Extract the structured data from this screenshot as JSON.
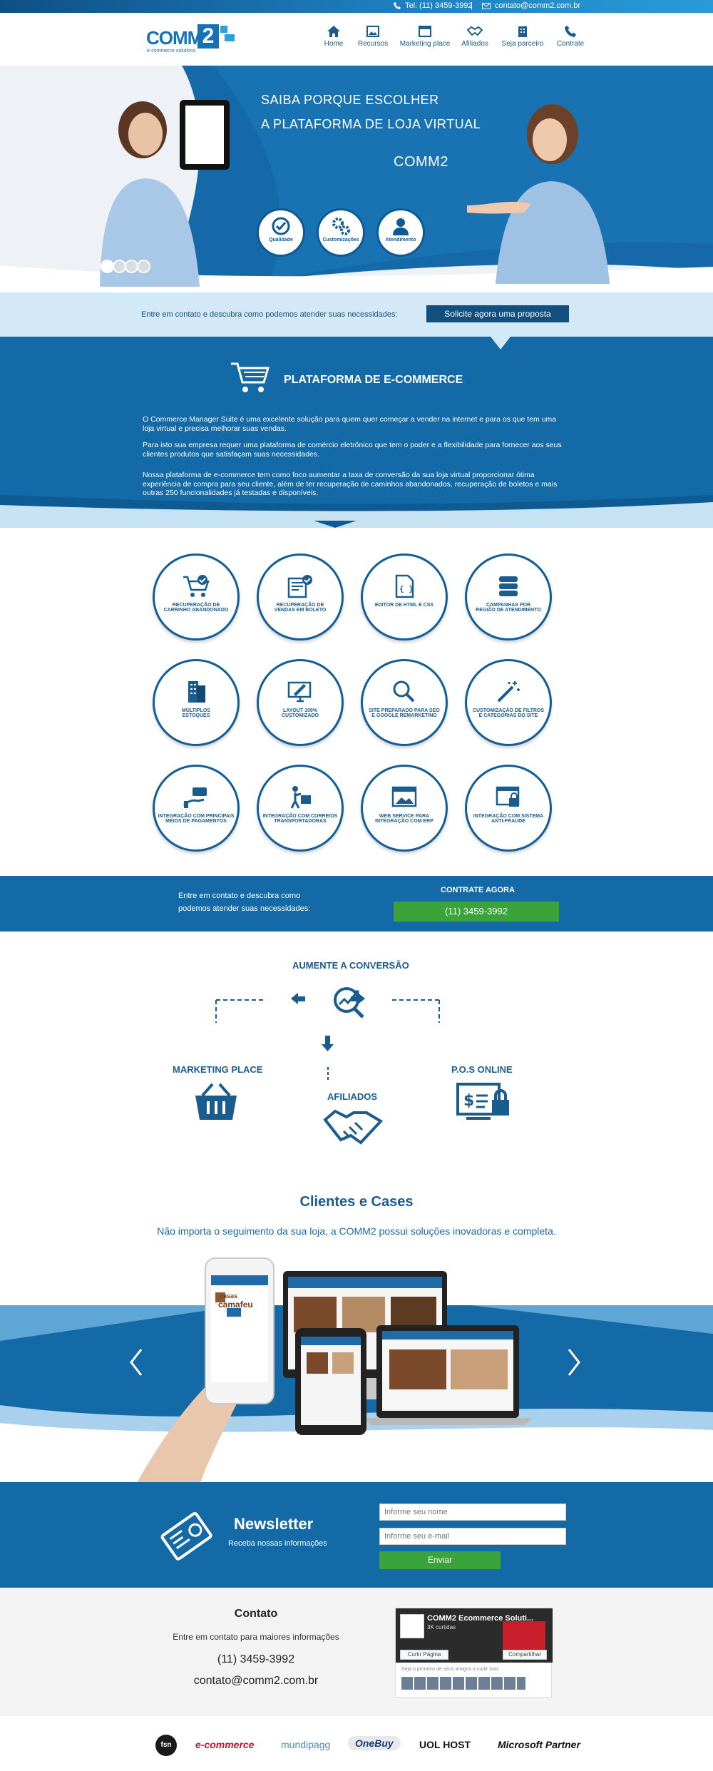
{
  "topbar": {
    "phone": "Tel: (11) 3459-3992",
    "separator": "|",
    "email": "contato@comm2.com.br"
  },
  "brand": {
    "logo_text": "COMM",
    "logo_number": "2",
    "logo_sub": "e-commerce solutions"
  },
  "nav": [
    {
      "label": "Home",
      "icon": "home-icon"
    },
    {
      "label": "Recursos",
      "icon": "image-icon"
    },
    {
      "label": "Marketing place",
      "icon": "browser-icon"
    },
    {
      "label": "Afiliados",
      "icon": "handshake-icon"
    },
    {
      "label": "Seja parceiro",
      "icon": "building-icon"
    },
    {
      "label": "Contrate",
      "icon": "phone-icon"
    }
  ],
  "hero": {
    "line1": "SAIBA PORQUE ESCOLHER",
    "line2": "A PLATAFORMA DE LOJA VIRTUAL",
    "line3": "COMM2",
    "badges": [
      "Qualidade",
      "Customizações",
      "Atendimento"
    ]
  },
  "cta": {
    "text": "Entre em contato e descubra como podemos atender suas necessidades:",
    "button": "Solicite agora uma proposta"
  },
  "platform": {
    "title": "PLATAFORMA DE E-COMMERCE",
    "p1": "O Commerce Manager Suite é uma excelente solução para quem quer começar a vender na internet e para os que tem uma loja virtual e precisa melhorar suas vendas.",
    "p2": "Para isto sua empresa requer uma plataforma de comércio eletrônico que tem o poder e a flexibilidade para fornecer aos seus clientes produtos que satisfaçam suas necessidades.",
    "p3": "Nossa plataforma de e-commerce tem como foco aumentar a taxa de conversão da sua loja virtual proporcionar ótima experiência de compra para seu cliente, além de ter recuperação de caminhos abandonados, recuperação de boletos e mais outras 250 funcionalidades já testadas e disponíveis."
  },
  "features": [
    {
      "l1": "RECUPERAÇÃO DE",
      "l2": "CARRINHO ABANDONADO",
      "icon": "cart-check-icon"
    },
    {
      "l1": "RECUPERAÇÃO DE",
      "l2": "VENDAS EM BOLETO",
      "icon": "invoice-icon"
    },
    {
      "l1": "EDITOR DE HTML E CSS",
      "l2": "",
      "icon": "code-file-icon"
    },
    {
      "l1": "CAMPANHAS POR",
      "l2": "REGIÃO DE ATENDIMENTO",
      "icon": "server-icon"
    },
    {
      "l1": "MÚLTIPLOS",
      "l2": "ESTOQUES",
      "icon": "buildings-icon"
    },
    {
      "l1": "LAYOUT 100%",
      "l2": "CUSTOMIZADO",
      "icon": "monitor-brush-icon"
    },
    {
      "l1": "SITE PREPARADO PARA SEO",
      "l2": "E GOOGLE REMARKETING",
      "icon": "magnifier-icon"
    },
    {
      "l1": "CUSTOMIZAÇÃO DE FILTROS",
      "l2": "E CATEGORIAS DO SITE",
      "icon": "magic-wand-icon"
    },
    {
      "l1": "INTEGRAÇÃO COM PRINCIPAIS",
      "l2": "MEIOS DE PAGAMENTOS",
      "icon": "hand-card-icon"
    },
    {
      "l1": "INTEGRAÇÃO COM CORREIOS",
      "l2": "TRANSPORTADORAS",
      "icon": "delivery-icon"
    },
    {
      "l1": "WEB SERVICE PARA",
      "l2": "INTEGRAÇÃO COM ERP",
      "icon": "web-window-icon"
    },
    {
      "l1": "INTEGRAÇÃO COM SISTEMA",
      "l2": "ANTI-FRAUDE",
      "icon": "lock-window-icon"
    }
  ],
  "contact_band": {
    "l1": "Entre em contato e descubra como",
    "l2": "podemos atender suas necessidades:",
    "cta_title": "CONTRATE AGORA",
    "phone": "(11) 3459-3992"
  },
  "conversion": {
    "title": "AUMENTE A CONVERSÃO",
    "left": "MARKETING PLACE",
    "center": "AFILIADOS",
    "right": "P.O.S ONLINE"
  },
  "cases": {
    "title": "Clientes e Cases",
    "subtitle": "Não importa o seguimento da sua loja, a COMM2 possui soluções inovadoras e completa.",
    "device_brand_1": "casas",
    "device_brand_2": "camafeu"
  },
  "newsletter": {
    "title": "Newsletter",
    "subtitle": "Receba nossas informações",
    "name_placeholder": "Informe seu nome",
    "email_placeholder": "Informe seu e-mail",
    "button": "Enviar"
  },
  "contact": {
    "title": "Contato",
    "subtitle": "Entre em contato para maiores informações",
    "phone": "(11) 3459-3992",
    "email": "contato@comm2.com.br"
  },
  "facebook": {
    "page_name": "COMM2 Ecommerce Soluti...",
    "likes": "3K curtidas",
    "like_button": "Curtir Página",
    "share_button": "Compartilhar",
    "friends_text": "Seja o primeiro de seus amigos a curtir isso"
  },
  "partners": [
    "fsn",
    "e-commerce",
    "mundipagg",
    "OneBuy",
    "UOL HOST",
    "Microsoft Partner"
  ],
  "colors": {
    "primary": "#136aa6",
    "dark": "#114f7e",
    "light": "#d3e9f7",
    "green": "#3aa43a"
  }
}
